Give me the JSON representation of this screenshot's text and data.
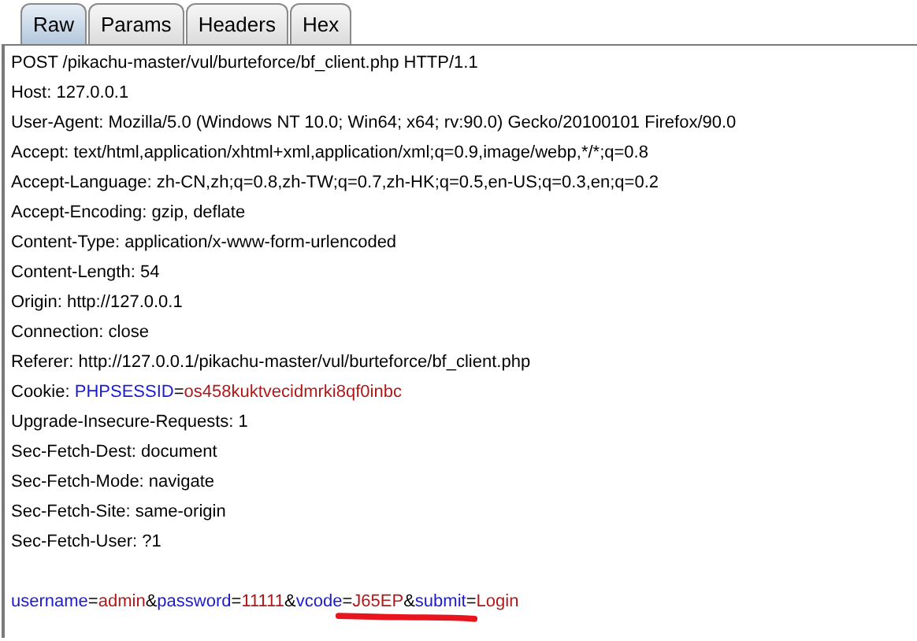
{
  "tabs": [
    {
      "label": "Raw",
      "selected": true
    },
    {
      "label": "Params",
      "selected": false
    },
    {
      "label": "Headers",
      "selected": false
    },
    {
      "label": "Hex",
      "selected": false
    }
  ],
  "request_lines": [
    [
      {
        "kind": "plain",
        "text": "POST /pikachu-master/vul/burteforce/bf_client.php HTTP/1.1"
      }
    ],
    [
      {
        "kind": "plain",
        "text": "Host: 127.0.0.1"
      }
    ],
    [
      {
        "kind": "plain",
        "text": "User-Agent: Mozilla/5.0 (Windows NT 10.0; Win64; x64; rv:90.0) Gecko/20100101 Firefox/90.0"
      }
    ],
    [
      {
        "kind": "plain",
        "text": "Accept: text/html,application/xhtml+xml,application/xml;q=0.9,image/webp,*/*;q=0.8"
      }
    ],
    [
      {
        "kind": "plain",
        "text": "Accept-Language: zh-CN,zh;q=0.8,zh-TW;q=0.7,zh-HK;q=0.5,en-US;q=0.3,en;q=0.2"
      }
    ],
    [
      {
        "kind": "plain",
        "text": "Accept-Encoding: gzip, deflate"
      }
    ],
    [
      {
        "kind": "plain",
        "text": "Content-Type: application/x-www-form-urlencoded"
      }
    ],
    [
      {
        "kind": "plain",
        "text": "Content-Length: 54"
      }
    ],
    [
      {
        "kind": "plain",
        "text": "Origin: http://127.0.0.1"
      }
    ],
    [
      {
        "kind": "plain",
        "text": "Connection: close"
      }
    ],
    [
      {
        "kind": "plain",
        "text": "Referer: http://127.0.0.1/pikachu-master/vul/burteforce/bf_client.php"
      }
    ],
    [
      {
        "kind": "plain",
        "text": "Cookie: "
      },
      {
        "kind": "name",
        "text": "PHPSESSID"
      },
      {
        "kind": "plain",
        "text": "="
      },
      {
        "kind": "value",
        "text": "os458kuktvecidmrki8qf0inbc"
      }
    ],
    [
      {
        "kind": "plain",
        "text": "Upgrade-Insecure-Requests: 1"
      }
    ],
    [
      {
        "kind": "plain",
        "text": "Sec-Fetch-Dest: document"
      }
    ],
    [
      {
        "kind": "plain",
        "text": "Sec-Fetch-Mode: navigate"
      }
    ],
    [
      {
        "kind": "plain",
        "text": "Sec-Fetch-Site: same-origin"
      }
    ],
    [
      {
        "kind": "plain",
        "text": "Sec-Fetch-User: ?1"
      }
    ]
  ],
  "body_line": [
    {
      "kind": "name",
      "text": "username"
    },
    {
      "kind": "plain",
      "text": "="
    },
    {
      "kind": "value",
      "text": "admin"
    },
    {
      "kind": "plain",
      "text": "&"
    },
    {
      "kind": "name",
      "text": "password"
    },
    {
      "kind": "plain",
      "text": "="
    },
    {
      "kind": "value",
      "text": "11111"
    },
    {
      "kind": "plain",
      "text": "&"
    },
    {
      "kind": "name",
      "text": "vcode"
    },
    {
      "kind": "plain",
      "text": "="
    },
    {
      "kind": "value",
      "text": "J65EP"
    },
    {
      "kind": "plain",
      "text": "&"
    },
    {
      "kind": "name",
      "text": "submit"
    },
    {
      "kind": "plain",
      "text": "="
    },
    {
      "kind": "value",
      "text": "Login"
    }
  ]
}
